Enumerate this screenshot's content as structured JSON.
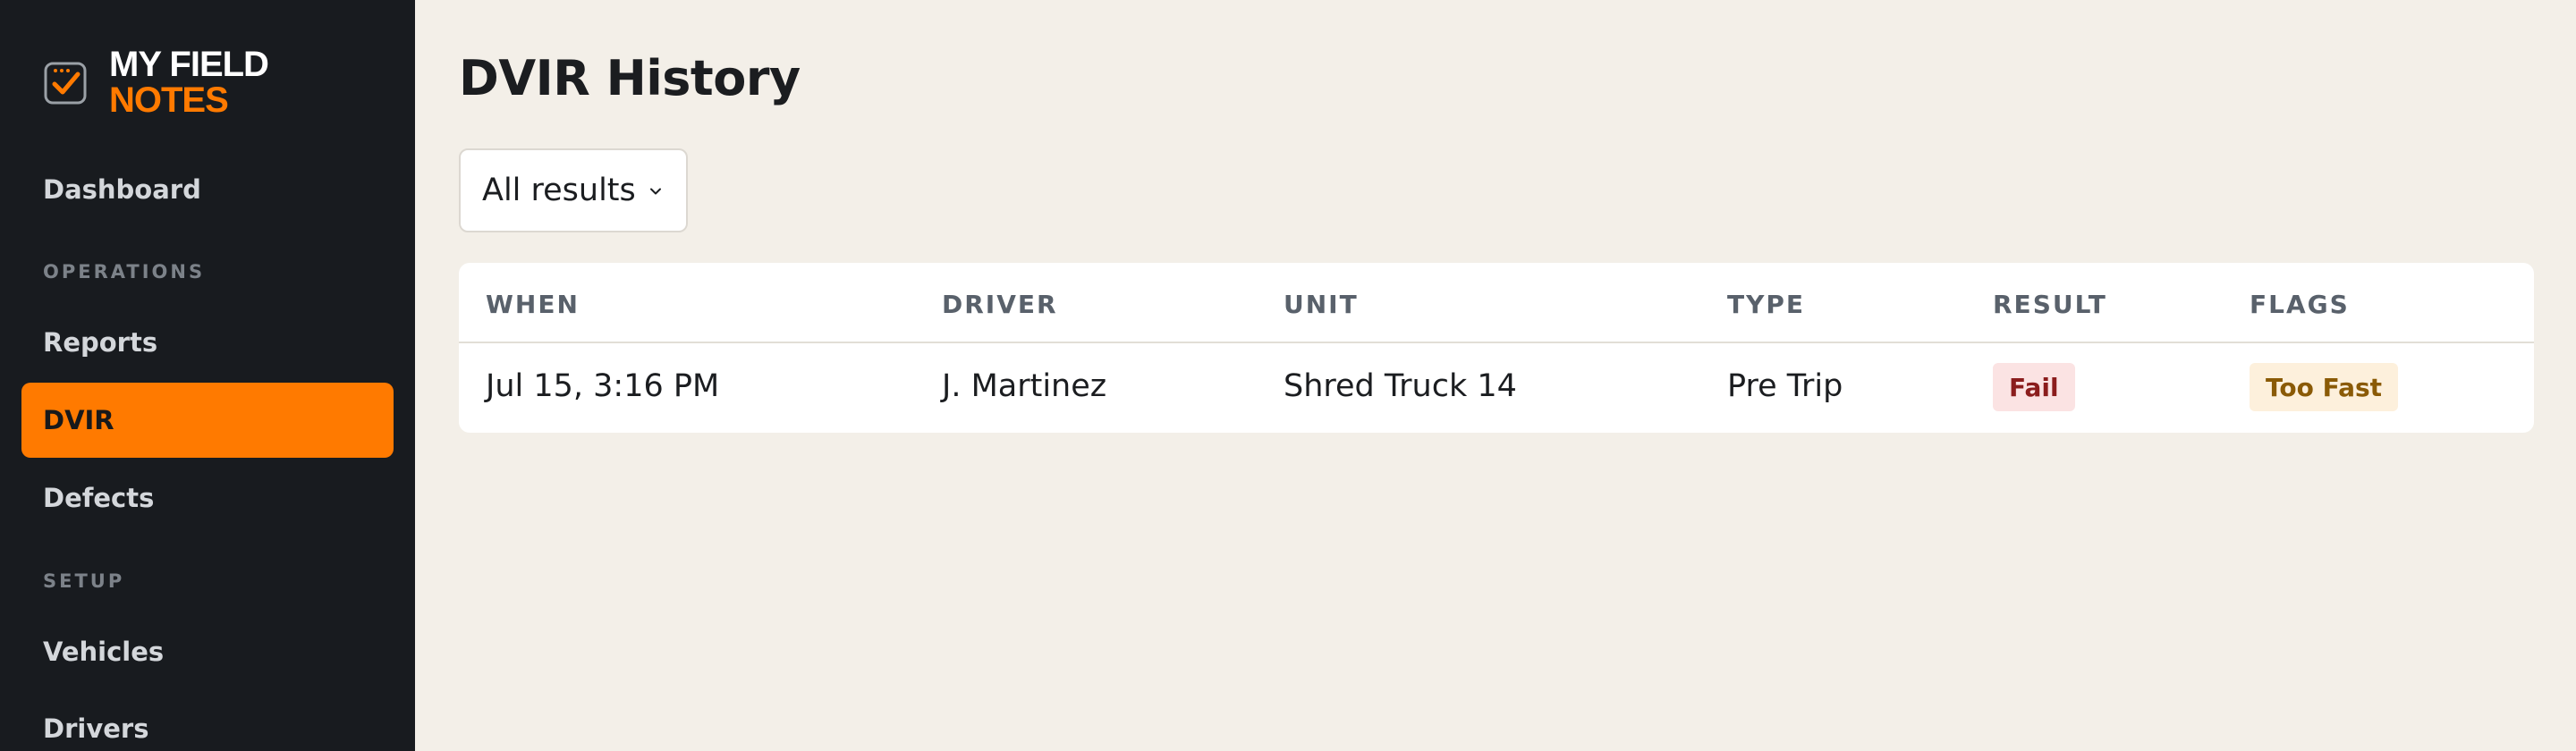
{
  "brand": {
    "line1": "MY FIELD",
    "line2": "NOTES",
    "icon": "checkbox-logo-icon",
    "accent_color": "#ff7a00"
  },
  "sidebar": {
    "items": [
      {
        "label": "Dashboard",
        "active": false
      },
      {
        "section": "OPERATIONS"
      },
      {
        "label": "Reports",
        "active": false
      },
      {
        "label": "DVIR",
        "active": true
      },
      {
        "label": "Defects",
        "active": false
      },
      {
        "section": "SETUP"
      },
      {
        "label": "Vehicles",
        "active": false
      },
      {
        "label": "Drivers",
        "active": false
      }
    ]
  },
  "main": {
    "title": "DVIR History",
    "filter": {
      "selected": "All results",
      "icon": "chevron-down-icon"
    },
    "table": {
      "columns": [
        "WHEN",
        "DRIVER",
        "UNIT",
        "TYPE",
        "RESULT",
        "FLAGS"
      ],
      "rows": [
        {
          "when": "Jul 15, 3:16 PM",
          "driver": "J. Martinez",
          "unit": "Shred Truck 14",
          "type": "Pre Trip",
          "result": "Fail",
          "flags": "Too Fast"
        }
      ]
    }
  },
  "colors": {
    "sidebar_bg": "#181b1f",
    "page_bg": "#f3efe8",
    "active_nav": "#ff7a00",
    "fail_badge_bg": "#fbe3e3",
    "fail_badge_text": "#8b1d1d",
    "flag_badge_bg": "#fdf0dc",
    "flag_badge_text": "#8a5a06"
  }
}
